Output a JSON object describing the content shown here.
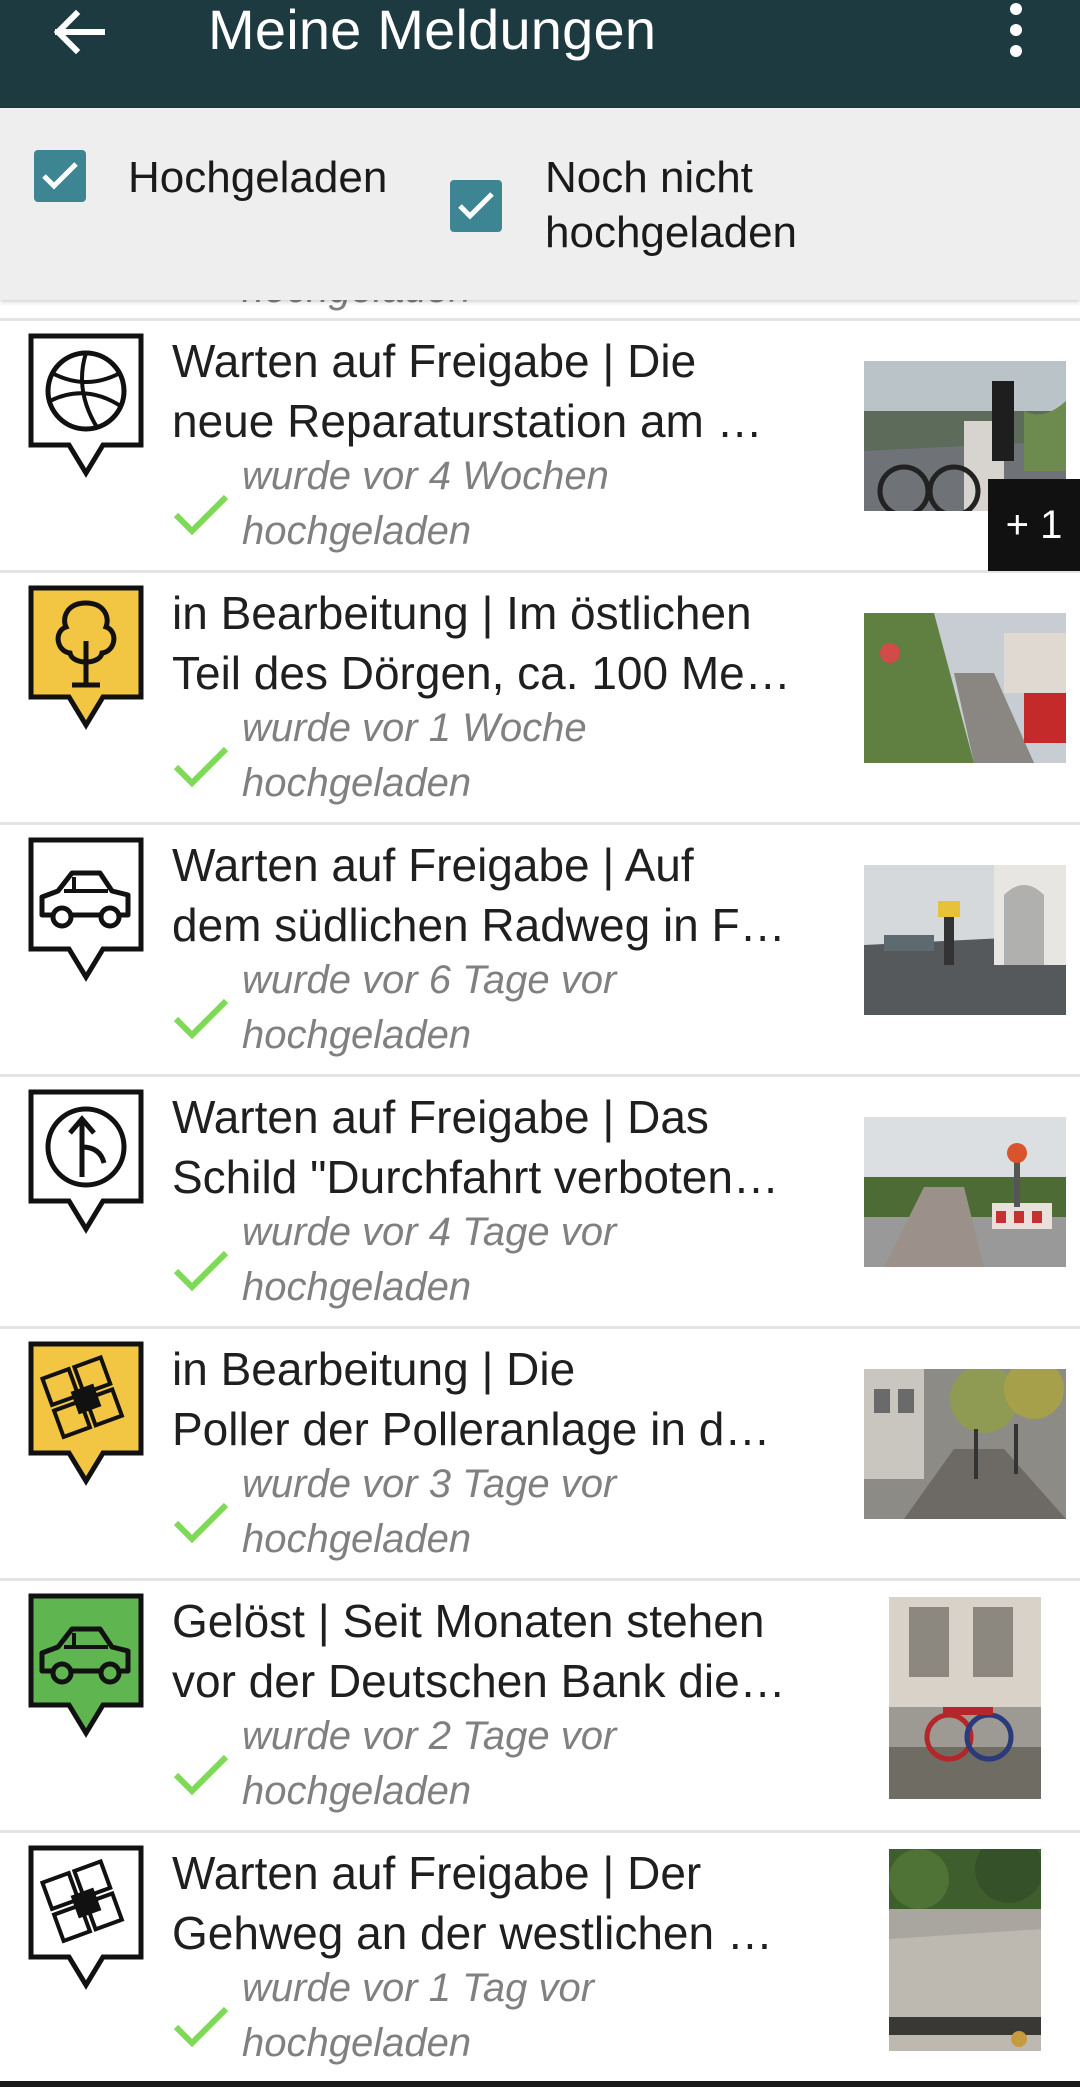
{
  "appbar": {
    "title": "Meine Meldungen",
    "back_icon": "arrow-left-icon",
    "menu_icon": "more-vert-icon",
    "color": "#1c3a40"
  },
  "filters": {
    "uploaded_label": "Hochgeladen",
    "uploaded_checked": true,
    "not_uploaded_label_1": "Noch nicht",
    "not_uploaded_label_2": "hochgeladen",
    "not_uploaded_checked": true,
    "checkbox_color": "#3e8593"
  },
  "list": {
    "clipped_previous_text": "hochgeladen",
    "items": [
      {
        "icon": "ball-icon",
        "icon_bg": "#ffffff",
        "title_1": "Warten auf Freigabe | Die",
        "title_2": "neue Reparaturstation am …",
        "status_1": "wurde vor 4 Wochen",
        "status_2": "hochgeladen",
        "thumb": "photo-bike-repair-station",
        "extra_photos": "+ 1"
      },
      {
        "icon": "tree-icon",
        "icon_bg": "#f2c542",
        "title_1": "in Bearbeitung | Im östlichen",
        "title_2": "Teil des Dörgen, ca. 100 Me…",
        "status_1": "wurde vor 1 Woche",
        "status_2": "hochgeladen",
        "thumb": "photo-overgrown-path"
      },
      {
        "icon": "car-icon",
        "icon_bg": "#ffffff",
        "title_1": "Warten auf Freigabe | Auf",
        "title_2": "dem südlichen Radweg in F…",
        "status_1": "wurde vor 6 Tage vor",
        "status_2": "hochgeladen",
        "thumb": "photo-wet-street"
      },
      {
        "icon": "traffic-sign-icon",
        "icon_bg": "#ffffff",
        "title_1": "Warten auf Freigabe | Das",
        "title_2": "Schild \"Durchfahrt verboten…",
        "status_1": "wurde vor 4 Tage vor",
        "status_2": "hochgeladen",
        "thumb": "photo-barrier-path"
      },
      {
        "icon": "paving-icon",
        "icon_bg": "#f2c542",
        "title_1": "in Bearbeitung | Die",
        "title_2": "Poller der Polleranlage in d…",
        "status_1": "wurde vor 3 Tage vor",
        "status_2": "hochgeladen",
        "thumb": "photo-bollards-street"
      },
      {
        "icon": "car-icon",
        "icon_bg": "#5fb550",
        "title_1": "Gelöst | Seit Monaten stehen",
        "title_2": "vor der Deutschen Bank die…",
        "status_1": "wurde vor 2 Tage vor",
        "status_2": "hochgeladen",
        "thumb": "photo-parked-bikes"
      },
      {
        "icon": "paving-icon",
        "icon_bg": "#ffffff",
        "title_1": "Warten auf Freigabe | Der",
        "title_2": "Gehweg an der westlichen …",
        "status_1": "wurde vor 1 Tag vor",
        "status_2": "hochgeladen",
        "thumb": "photo-sidewalk-grate"
      }
    ]
  },
  "check_color": "#7ed957"
}
